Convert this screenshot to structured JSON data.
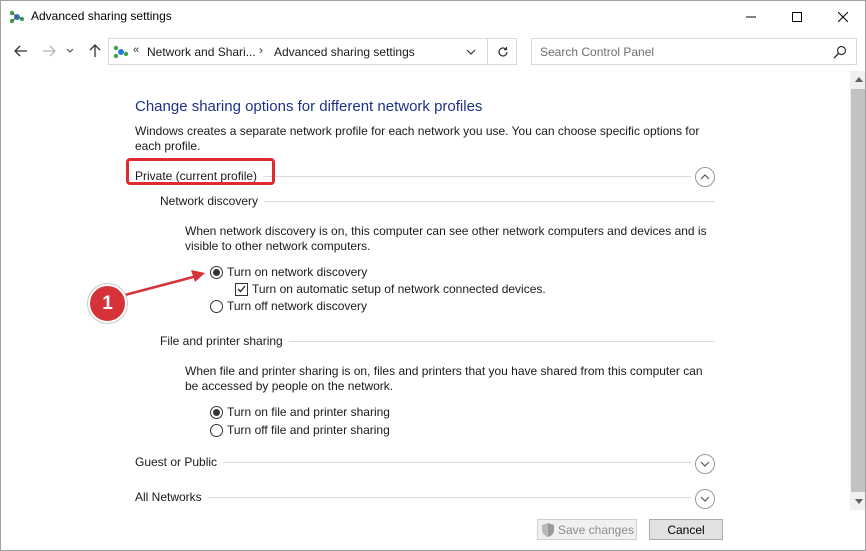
{
  "window": {
    "title": "Advanced sharing settings"
  },
  "address_bar": {
    "prefix": "«",
    "crumbs": [
      "Network and Shari...",
      "Advanced sharing settings"
    ],
    "separator": "›"
  },
  "search": {
    "placeholder": "Search Control Panel"
  },
  "main": {
    "heading": "Change sharing options for different network profiles",
    "intro": "Windows creates a separate network profile for each network you use. You can choose specific options for each profile.",
    "private_profile": {
      "title": "Private (current profile)",
      "network_discovery": {
        "title": "Network discovery",
        "description": "When network discovery is on, this computer can see other network computers and devices and is visible to other network computers.",
        "option_on": "Turn on network discovery",
        "auto_setup": "Turn on automatic setup of network connected devices.",
        "option_off": "Turn off network discovery",
        "selected": "on",
        "auto_setup_checked": true
      },
      "file_printer_sharing": {
        "title": "File and printer sharing",
        "description": "When file and printer sharing is on, files and printers that you have shared from this computer can be accessed by people on the network.",
        "option_on": "Turn on file and printer sharing",
        "option_off": "Turn off file and printer sharing",
        "selected": "on"
      }
    },
    "guest_public": {
      "title": "Guest or Public"
    },
    "all_networks": {
      "title": "All Networks"
    }
  },
  "annotation": {
    "badge_number": "1",
    "color": "#d6323a"
  },
  "footer": {
    "save_label": "Save changes",
    "cancel_label": "Cancel"
  },
  "icons": {
    "app": "network-icon",
    "back": "arrow-left-icon",
    "forward": "arrow-right-icon",
    "up": "arrow-up-icon",
    "refresh": "refresh-icon",
    "search": "search-icon",
    "shield": "uac-shield-icon"
  },
  "colors": {
    "heading": "#1e3287",
    "highlight": "#e02a32"
  }
}
